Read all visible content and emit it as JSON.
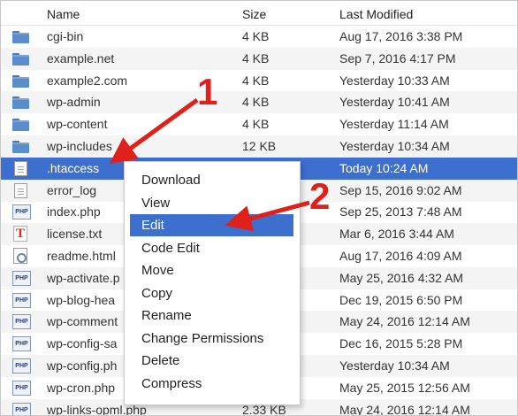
{
  "header": {
    "name": "Name",
    "size": "Size",
    "last_modified": "Last Modified"
  },
  "files": [
    {
      "name": "cgi-bin",
      "size": "4 KB",
      "modified": "Aug 17, 2016 3:38 PM",
      "icon": "folder-icon"
    },
    {
      "name": "example.net",
      "size": "4 KB",
      "modified": "Sep 7, 2016 4:17 PM",
      "icon": "folder-icon"
    },
    {
      "name": "example2.com",
      "size": "4 KB",
      "modified": "Yesterday 10:33 AM",
      "icon": "folder-icon"
    },
    {
      "name": "wp-admin",
      "size": "4 KB",
      "modified": "Yesterday 10:41 AM",
      "icon": "folder-icon"
    },
    {
      "name": "wp-content",
      "size": "4 KB",
      "modified": "Yesterday 11:14 AM",
      "icon": "folder-icon"
    },
    {
      "name": "wp-includes",
      "size": "12 KB",
      "modified": "Yesterday 10:34 AM",
      "icon": "folder-icon"
    },
    {
      "name": ".htaccess",
      "size": "",
      "modified": "Today 10:24 AM",
      "icon": "document-icon",
      "selected": true
    },
    {
      "name": "error_log",
      "size": "",
      "modified": "Sep 15, 2016 9:02 AM",
      "icon": "document-icon"
    },
    {
      "name": "index.php",
      "size": "",
      "modified": "Sep 25, 2013 7:48 AM",
      "icon": "php-file-icon"
    },
    {
      "name": "license.txt",
      "size": "",
      "modified": "Mar 6, 2016 3:44 AM",
      "icon": "text-file-icon"
    },
    {
      "name": "readme.html",
      "size": "",
      "modified": "Aug 17, 2016 4:09 AM",
      "icon": "html-file-icon"
    },
    {
      "name": "wp-activate.p",
      "size": "",
      "modified": "May 25, 2016 4:32 AM",
      "icon": "php-file-icon"
    },
    {
      "name": "wp-blog-hea",
      "size": "",
      "modified": "Dec 19, 2015 6:50 PM",
      "icon": "php-file-icon"
    },
    {
      "name": "wp-comment",
      "size": "",
      "modified": "May 24, 2016 12:14 AM",
      "icon": "php-file-icon"
    },
    {
      "name": "wp-config-sa",
      "size": "",
      "modified": "Dec 16, 2015 5:28 PM",
      "icon": "php-file-icon"
    },
    {
      "name": "wp-config.ph",
      "size": "",
      "modified": "Yesterday 10:34 AM",
      "icon": "php-file-icon"
    },
    {
      "name": "wp-cron.php",
      "size": "",
      "modified": "May 25, 2015 12:56 AM",
      "icon": "php-file-icon"
    },
    {
      "name": "wp-links-opml.php",
      "size": "2.33 KB",
      "modified": "May 24, 2016 12:14 AM",
      "icon": "php-file-icon"
    }
  ],
  "php_icon_label": "PHP",
  "txt_icon_label": "T",
  "context_menu": [
    {
      "label": "Download"
    },
    {
      "label": "View"
    },
    {
      "label": "Edit",
      "active": true
    },
    {
      "label": "Code Edit"
    },
    {
      "label": "Move"
    },
    {
      "label": "Copy"
    },
    {
      "label": "Rename"
    },
    {
      "label": "Change Permissions"
    },
    {
      "label": "Delete"
    },
    {
      "label": "Compress"
    }
  ],
  "annotations": {
    "step1": "1",
    "step2": "2"
  },
  "colors": {
    "selection": "#3d6fcf",
    "annotation": "#e0201b",
    "folder": "#5b8ccb"
  }
}
